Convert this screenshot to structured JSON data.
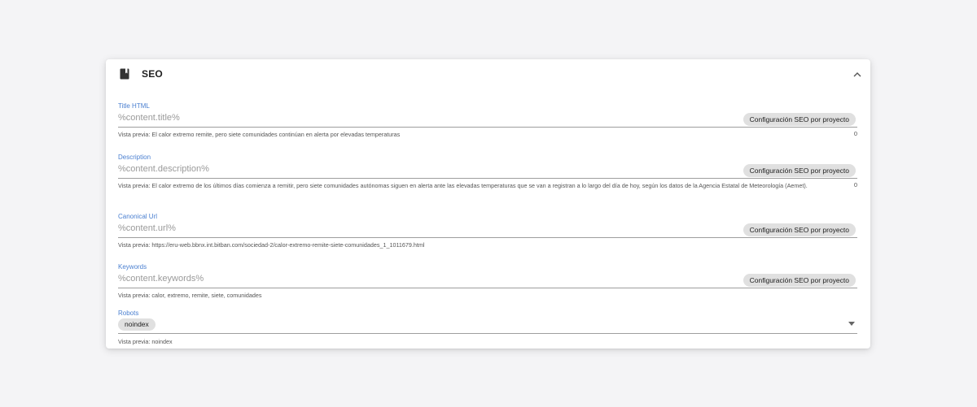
{
  "section": {
    "title": "SEO",
    "icon": "book-icon",
    "collapse_icon": "chevron-up-icon"
  },
  "fields": [
    {
      "label": "Title HTML",
      "value": "%content.title%",
      "button": "Configuración SEO por proyecto",
      "preview": "Vista previa: El calor extremo remite, pero siete comunidades continúan en alerta por elevadas temperaturas",
      "counter": "0"
    },
    {
      "label": "Description",
      "value": "%content.description%",
      "button": "Configuración SEO por proyecto",
      "preview": "Vista previa: El calor extremo de los últimos días comienza a remitir, pero siete comunidades autónomas siguen en alerta ante las elevadas temperaturas que se van a registran a lo largo del día de hoy, según los datos de la Agencia Estatal de Meteorología (Aemet).",
      "counter": "0"
    },
    {
      "label": "Canonical Url",
      "value": "%content.url%",
      "button": "Configuración SEO por proyecto",
      "preview": "Vista previa: https://eru-web.bbnx.int.bitban.com/sociedad-2/calor-extremo-remite-siete-comunidades_1_1011679.html"
    },
    {
      "label": "Keywords",
      "value": "%content.keywords%",
      "button": "Configuración SEO por proyecto",
      "preview": "Vista previa: calor, extremo, remite, siete, comunidades"
    }
  ],
  "robots": {
    "label": "Robots",
    "selected": "noindex",
    "preview": "Vista previa: noindex",
    "dropdown_icon": "caret-down-icon"
  }
}
